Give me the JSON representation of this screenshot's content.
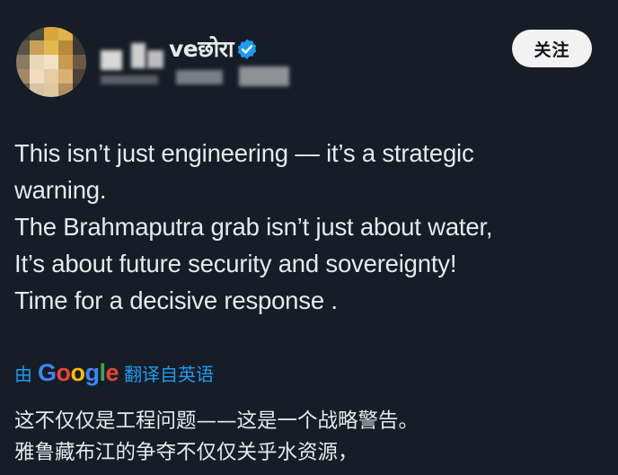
{
  "post": {
    "author_name_visible": "veछोरा",
    "follow_label": "关注",
    "text_lines": [
      "This isn’t just engineering — it’s a strategic",
      "warning.",
      "The Brahmaputra grab isn’t just about water,",
      "It’s about future security and sovereignty!",
      "Time for a decisive response ."
    ],
    "translate": {
      "by_label": "由",
      "brand_letters": [
        "G",
        "o",
        "o",
        "g",
        "l",
        "e"
      ],
      "suffix_label": "翻译自英语"
    },
    "translated_lines": [
      "这不仅仅是工程问题——这是一个战略警告。",
      "雅鲁藏布江的争夺不仅仅关乎水资源，"
    ]
  },
  "icons": {
    "verified": "verified-badge-icon",
    "avatar": "pixelated-avatar"
  },
  "colors": {
    "background": "#161d27",
    "text": "#e7e9ea",
    "link": "#1d9bf0",
    "verified": "#1d9bf0",
    "google_blue": "#4285f4",
    "google_red": "#ea4335",
    "google_yellow": "#fbbc05",
    "google_green": "#34a853"
  }
}
